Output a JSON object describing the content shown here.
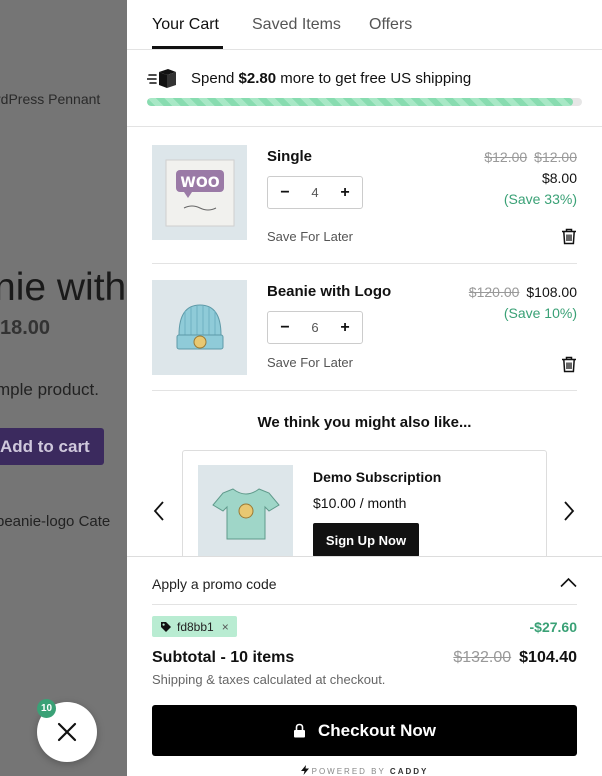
{
  "background": {
    "pennant_text": "rdPress Pennant",
    "product_title": "nie with",
    "product_price": "18.00",
    "product_desc": "mple product.",
    "add_to_cart": "Add to cart",
    "meta_text": "beanie-logo Cate"
  },
  "fab": {
    "badge_count": "10"
  },
  "tabs": [
    {
      "label": "Your Cart",
      "active": true
    },
    {
      "label": "Saved Items",
      "active": false
    },
    {
      "label": "Offers",
      "active": false
    }
  ],
  "shipping": {
    "prefix": "Spend ",
    "amount": "$2.80",
    "suffix": " more to get free US shipping",
    "progress_percent": 97.9
  },
  "cart_items": [
    {
      "name": "Single",
      "quantity": "4",
      "regular_price": "$12.00",
      "regular_price_2": "$12.00",
      "sale_price": "$8.00",
      "savings": "(Save 33%)",
      "save_for_later": "Save For Later"
    },
    {
      "name": "Beanie with Logo",
      "quantity": "6",
      "regular_price": "$120.00",
      "sale_price": "$108.00",
      "savings": "(Save 10%)",
      "save_for_later": "Save For Later"
    }
  ],
  "recommendations": {
    "title": "We think you might also like...",
    "product": {
      "name": "Demo Subscription",
      "price": "$10.00 / month",
      "button": "Sign Up Now"
    }
  },
  "footer": {
    "promo_label": "Apply a promo code",
    "coupon_code": "fd8bb1",
    "coupon_remove": "×",
    "discount": "-$27.60",
    "subtotal_label": "Subtotal - 10 items",
    "subtotal_old": "$132.00",
    "subtotal_new": "$104.40",
    "tax_note": "Shipping & taxes calculated at checkout.",
    "checkout_label": "Checkout Now",
    "powered_prefix": "POWERED BY ",
    "powered_brand": "CADDY"
  },
  "colors": {
    "accent_green": "#3aa176",
    "progress_green": "#88dcb0",
    "coupon_bg": "#b9ecd2",
    "button_dark": "#000000"
  }
}
